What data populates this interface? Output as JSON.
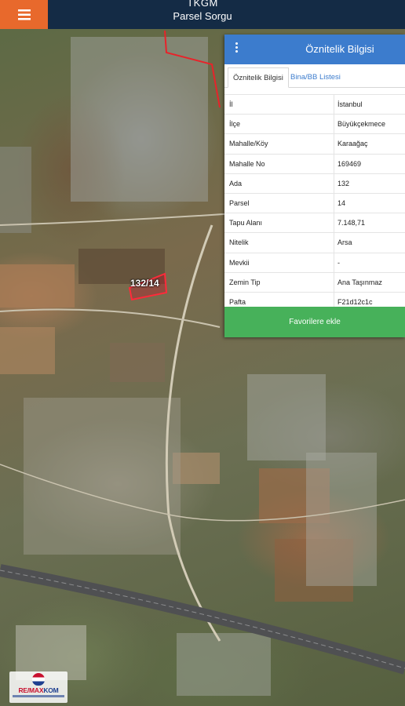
{
  "header": {
    "title": "TKGM",
    "subtitle": "Parsel Sorgu",
    "menu_icon": "hamburger-menu-icon",
    "colors": {
      "bar": "#142b45",
      "menu": "#e8692c"
    }
  },
  "map": {
    "parcel_label": "132/14"
  },
  "panel": {
    "title": "Öznitelik Bilgisi",
    "menu_icon": "kebab-menu-icon",
    "tabs": [
      {
        "label": "Öznitelik Bilgisi",
        "active": true
      },
      {
        "label": "Bina/BB Listesi",
        "active": false
      }
    ],
    "rows": [
      {
        "key": "İl",
        "value": "İstanbul"
      },
      {
        "key": "İlçe",
        "value": "Büyükçekmece"
      },
      {
        "key": "Mahalle/Köy",
        "value": "Karaağaç"
      },
      {
        "key": "Mahalle No",
        "value": "169469"
      },
      {
        "key": "Ada",
        "value": "132"
      },
      {
        "key": "Parsel",
        "value": "14"
      },
      {
        "key": "Tapu Alanı",
        "value": "7.148,71"
      },
      {
        "key": "Nitelik",
        "value": "Arsa"
      },
      {
        "key": "Mevkii",
        "value": "-"
      },
      {
        "key": "Zemin Tip",
        "value": "Ana Taşınmaz"
      },
      {
        "key": "Pafta",
        "value": "F21d12c1c"
      }
    ],
    "favorite_button": "Favorilere ekle",
    "colors": {
      "header": "#3c7ccd",
      "button": "#47b15a"
    }
  },
  "logo": {
    "text_left": "RE/MAX",
    "text_right": "KOM"
  }
}
